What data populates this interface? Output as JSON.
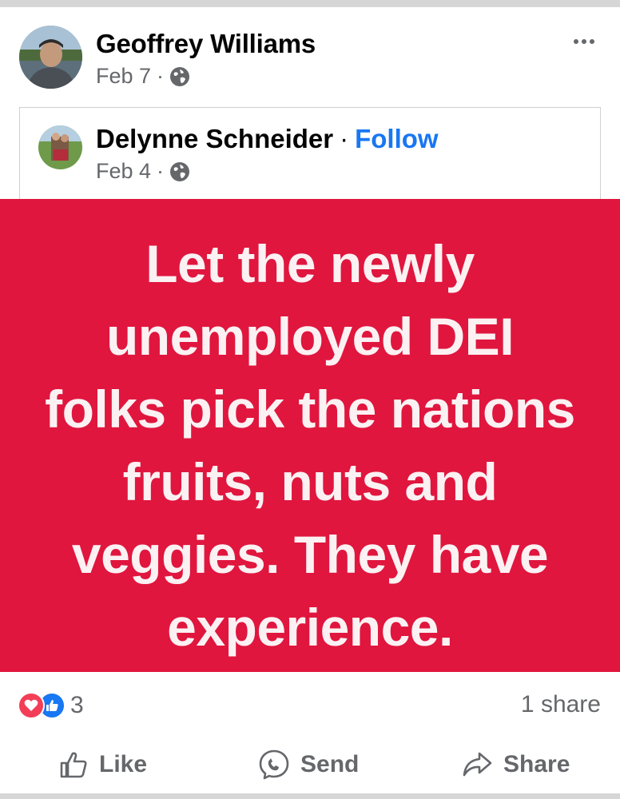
{
  "post": {
    "author_name": "Geoffrey Williams",
    "date": "Feb 7",
    "meta_separator": "·",
    "more_icon": "more-horizontal-icon"
  },
  "shared_post": {
    "author_name": "Delynne Schneider",
    "separator": "·",
    "follow_label": "Follow",
    "date": "Feb 4",
    "meta_separator": "·"
  },
  "image": {
    "background_color": "#e0163e",
    "text_lines": [
      "Let the newly",
      "unemployed DEI",
      "folks pick the nations",
      "fruits, nuts and",
      "veggies. They have",
      "experience."
    ]
  },
  "engagement": {
    "reaction_icons": [
      "love-icon",
      "like-icon"
    ],
    "reaction_count": "3",
    "share_count": "1 share"
  },
  "actions": {
    "like_label": "Like",
    "send_label": "Send",
    "share_label": "Share"
  },
  "colors": {
    "link_blue": "#1877f2",
    "love_red": "#f33e58",
    "meta_gray": "#65676b"
  }
}
